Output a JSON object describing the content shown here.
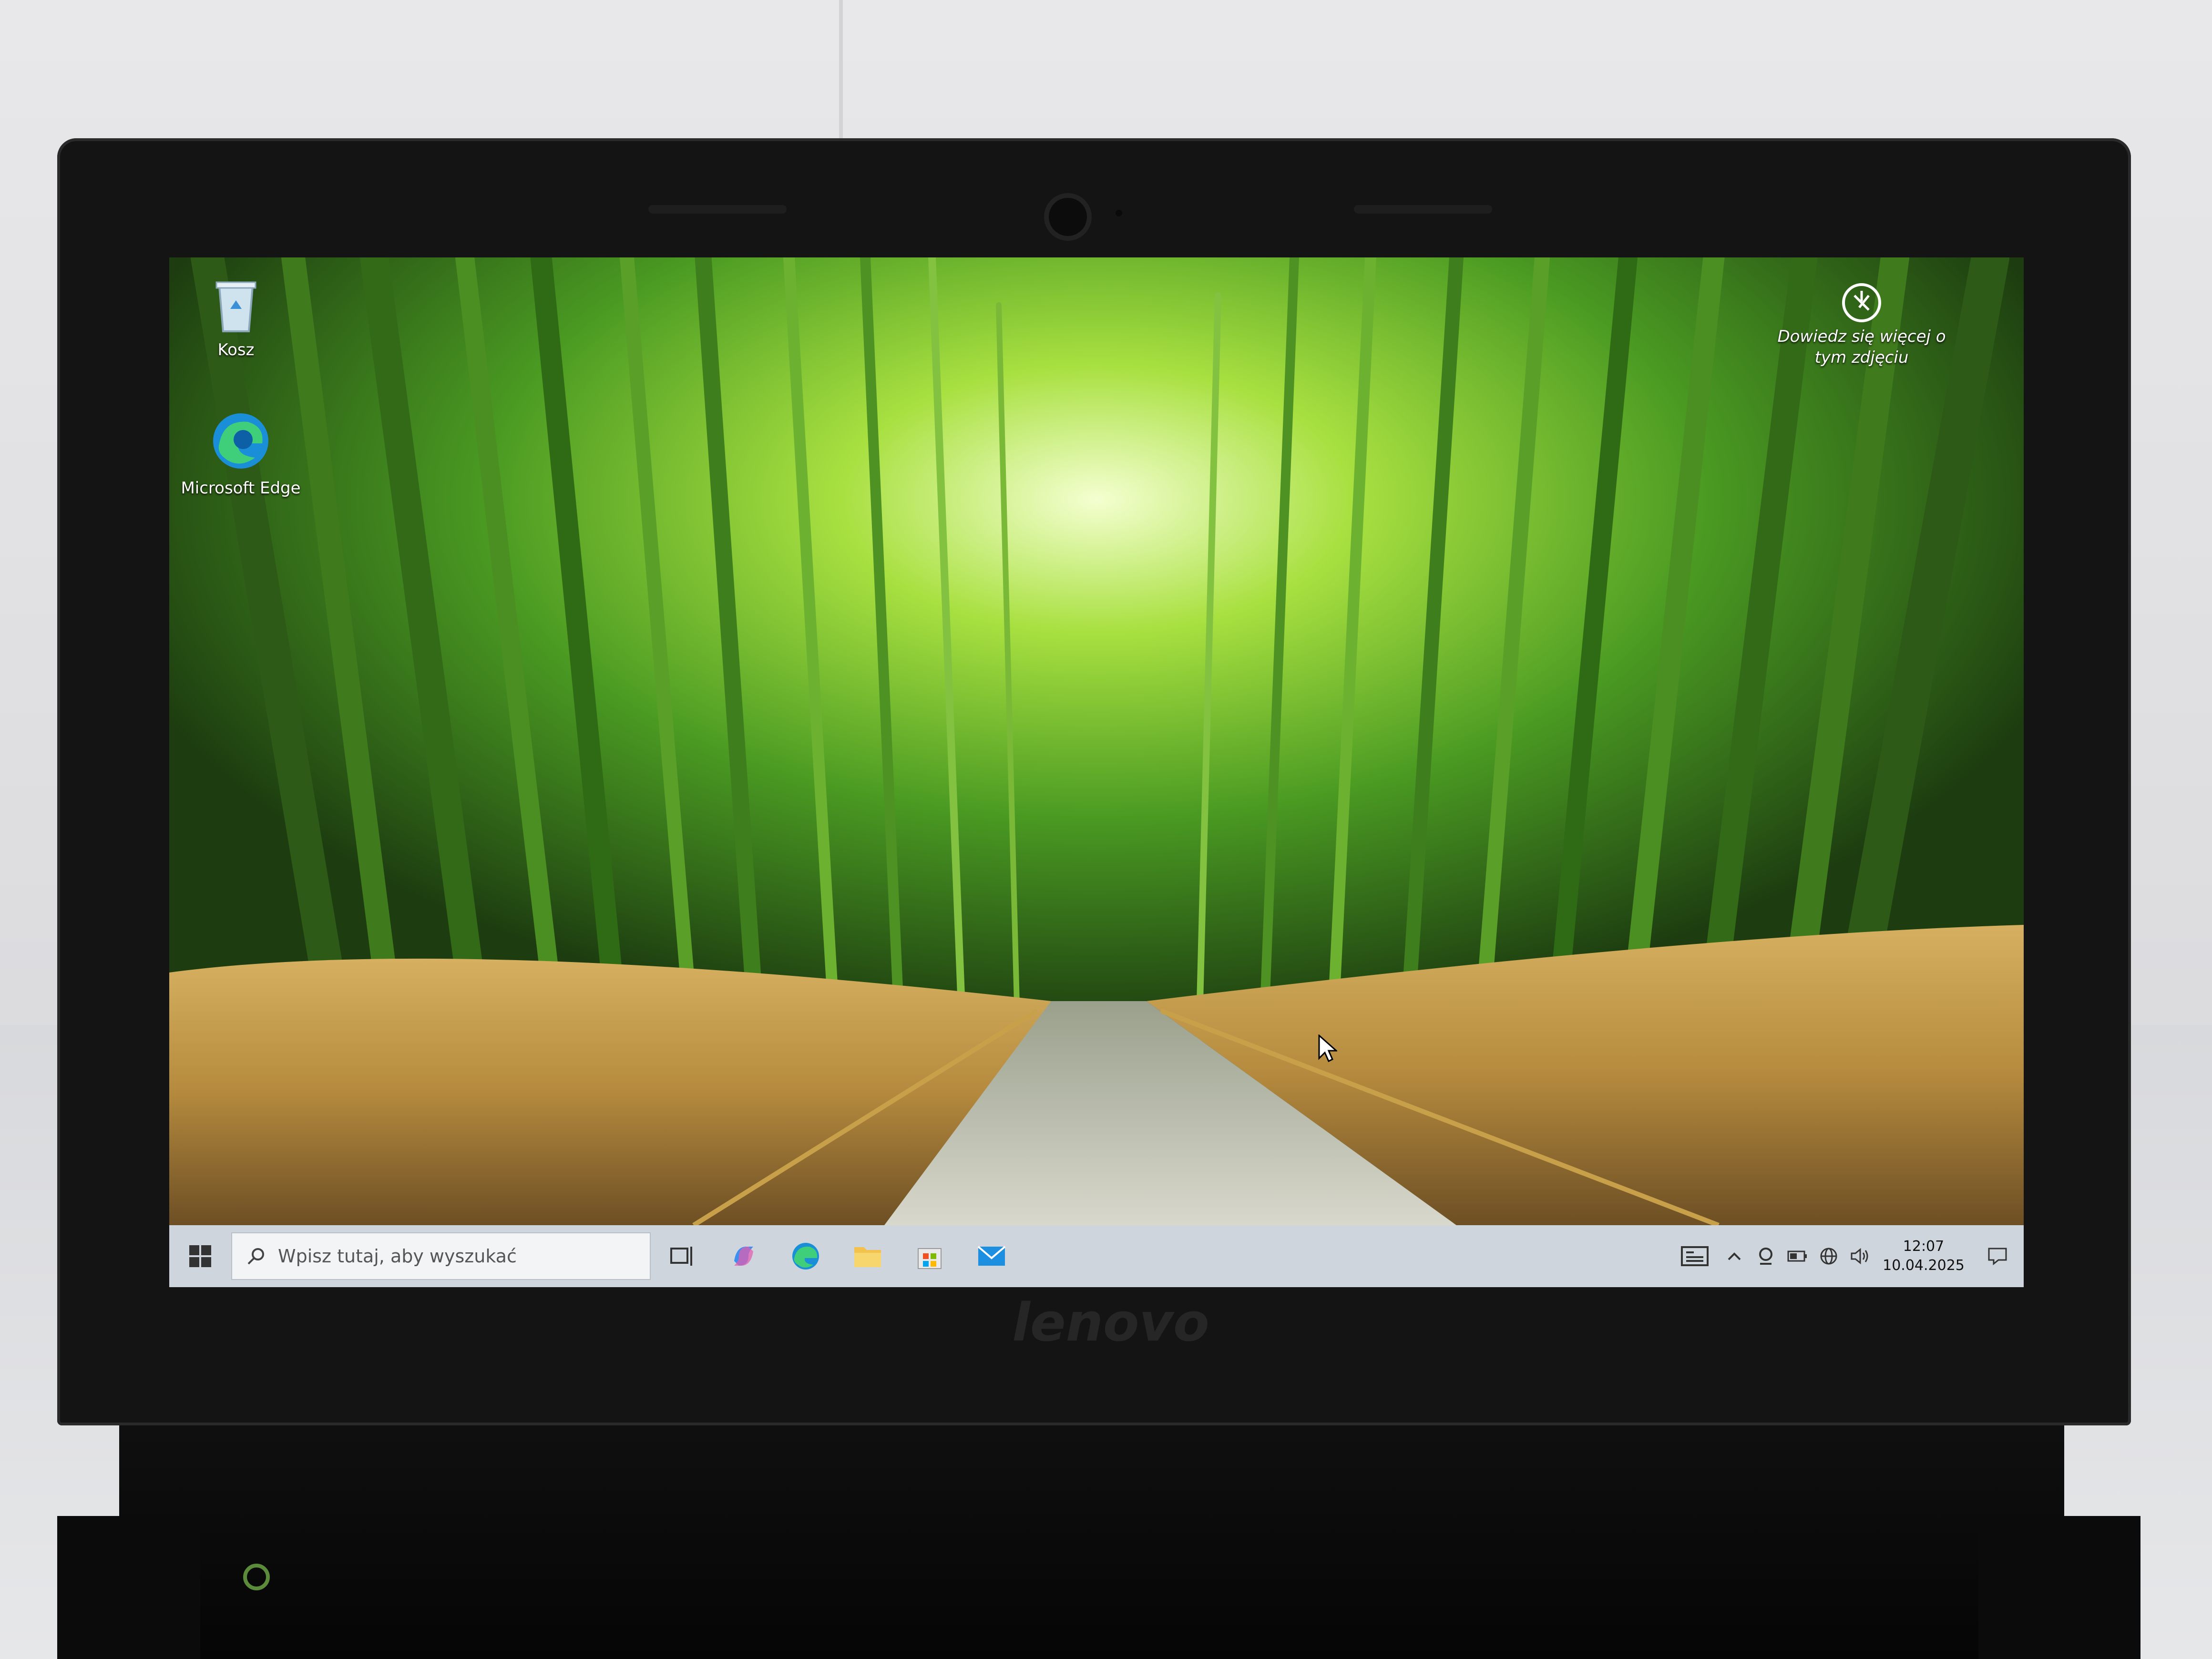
{
  "desktop": {
    "icons": [
      {
        "label": "Kosz"
      },
      {
        "label": "Microsoft Edge"
      }
    ],
    "spotlight": {
      "label_line1": "Dowiedz się więcej o",
      "label_line2": "tym zdjęciu"
    }
  },
  "taskbar": {
    "search_placeholder": "Wpisz tutaj, aby wyszukać",
    "pinned": [
      "task-view-icon",
      "copilot-icon",
      "edge-icon",
      "file-explorer-icon",
      "store-icon",
      "mail-icon"
    ],
    "tray_icons": [
      "news-widget-icon",
      "chevron-up-icon",
      "camera-icon",
      "battery-icon",
      "network-globe-icon",
      "volume-icon"
    ],
    "time": "12:07",
    "date": "10.04.2025"
  },
  "colors": {
    "taskbar": "#cfd5dc",
    "bamboo_green": "#3f8f1f",
    "grass_gold": "#c9a04a"
  }
}
